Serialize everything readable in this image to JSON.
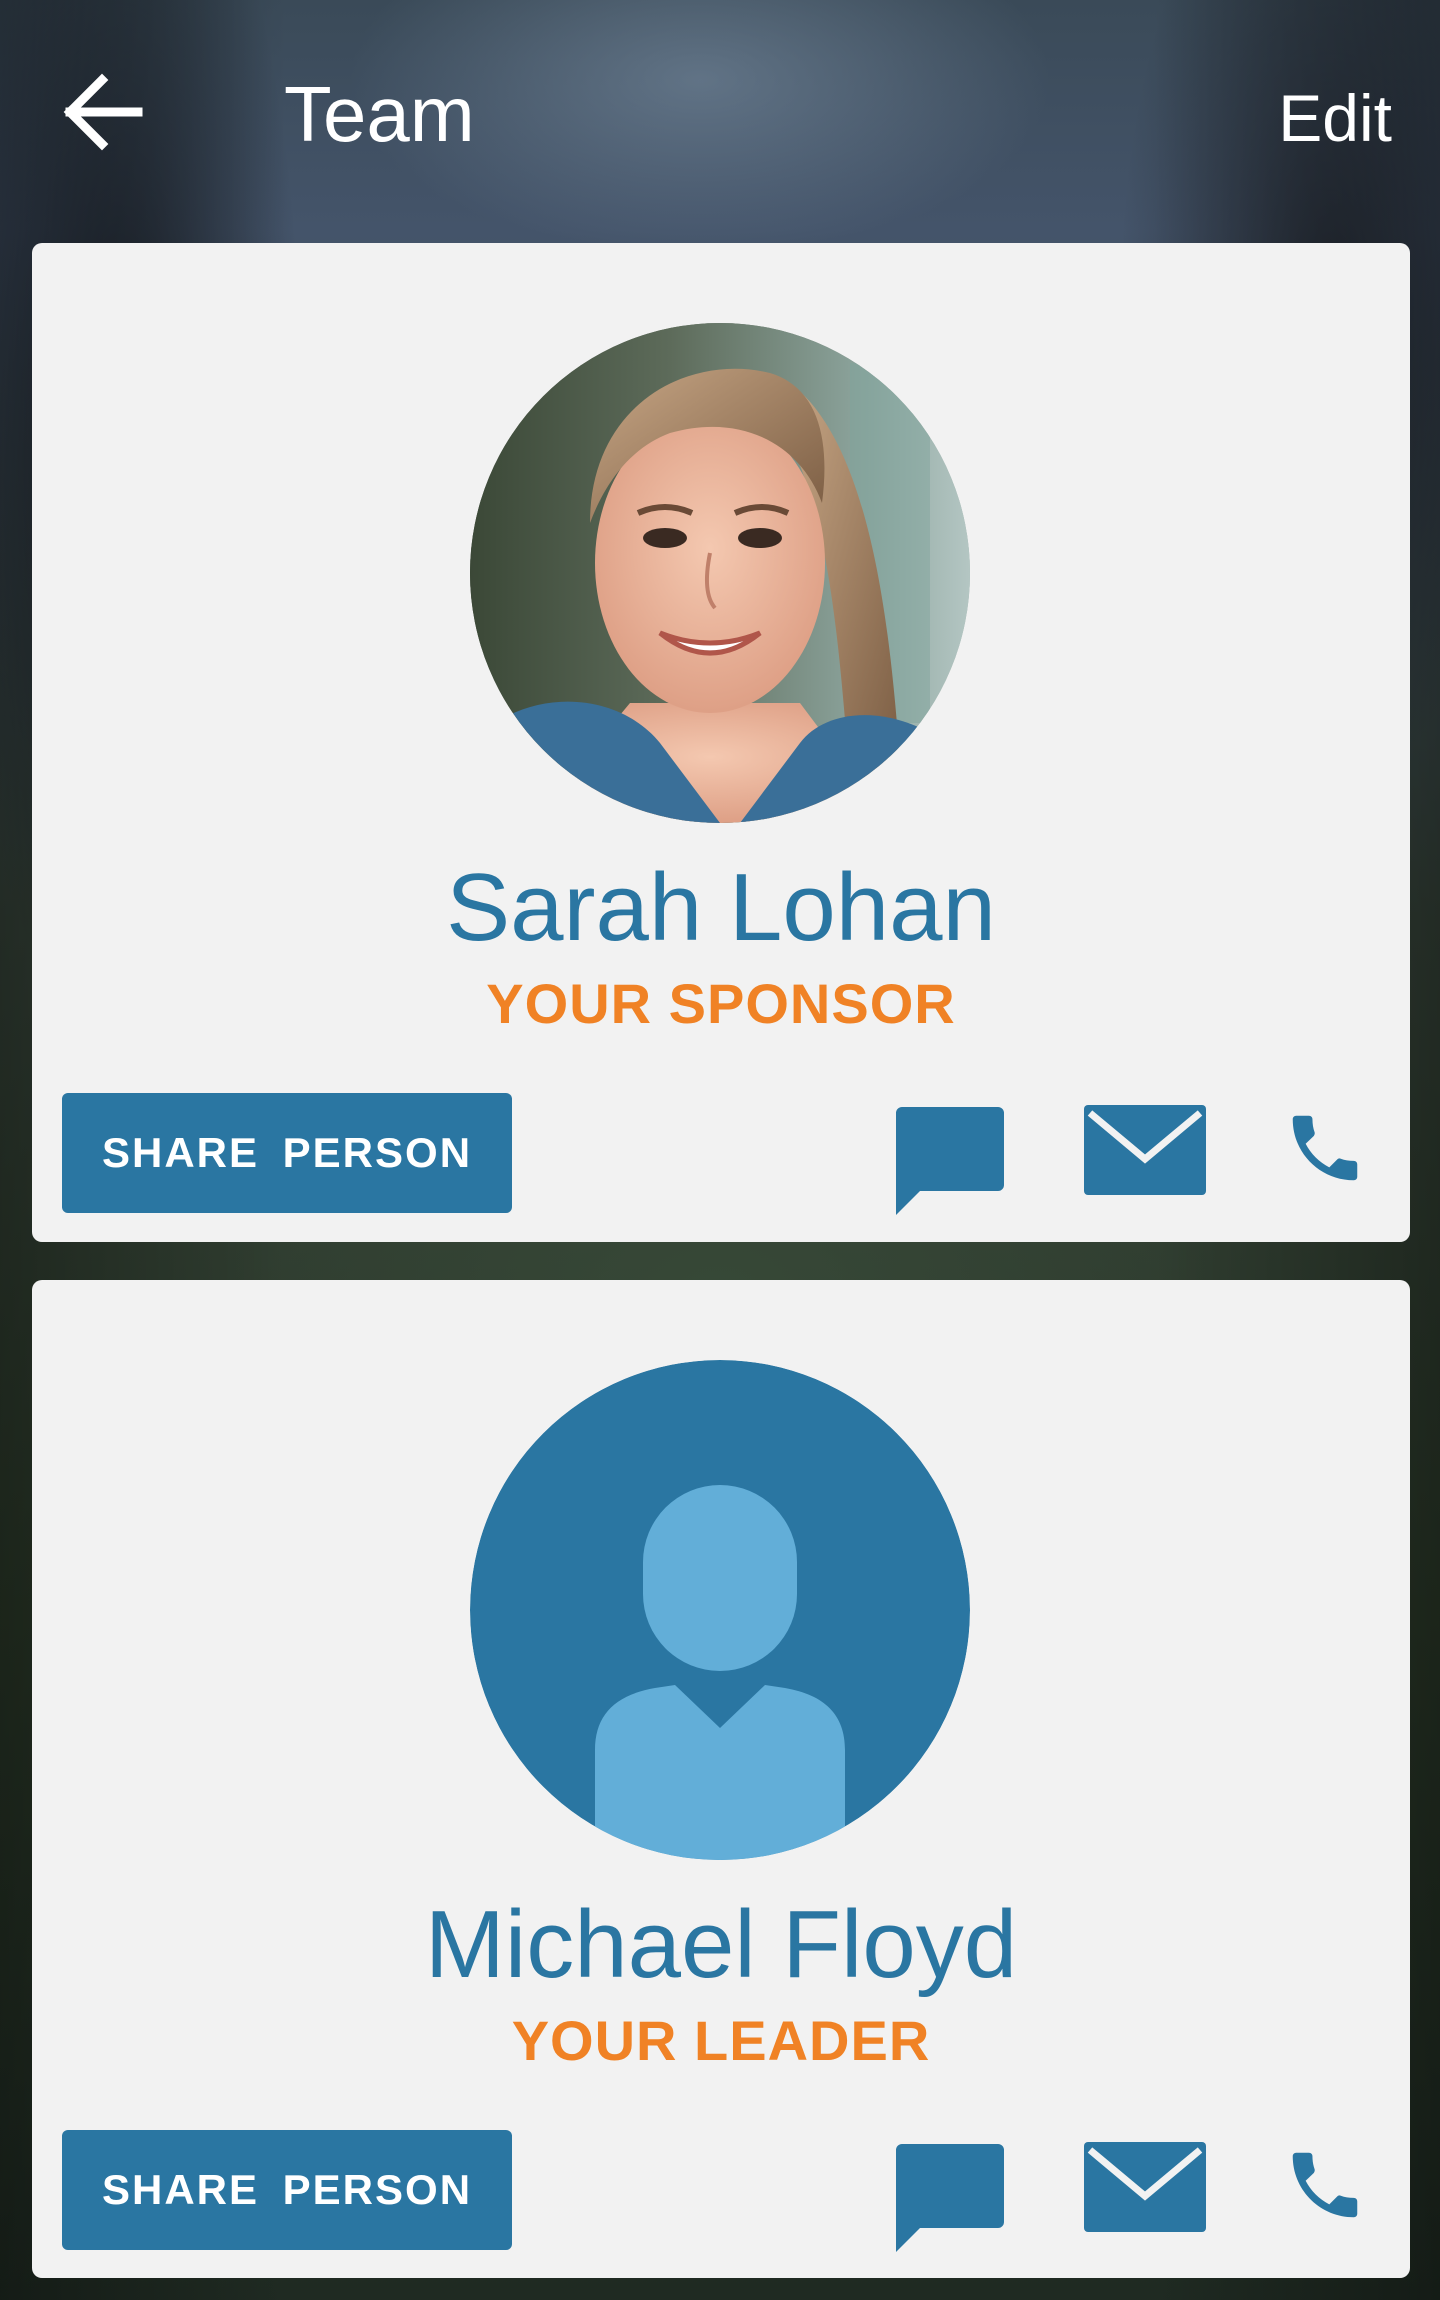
{
  "header": {
    "title": "Team",
    "edit_label": "Edit",
    "back_icon": "arrow-left-icon"
  },
  "team": [
    {
      "name": "Sarah Lohan",
      "role": "YOUR SPONSOR",
      "avatar": "profile-photo",
      "share_label": "SHARE  PERSON"
    },
    {
      "name": "Michael Floyd",
      "role": "YOUR LEADER",
      "avatar": "default-avatar-icon",
      "share_label": "SHARE  PERSON"
    }
  ],
  "colors": {
    "accent_blue": "#2a76a2",
    "avatar_light_blue": "#62aed8",
    "role_orange": "#f08225",
    "card_bg": "#f2f2f2",
    "header_text": "#ffffff"
  }
}
